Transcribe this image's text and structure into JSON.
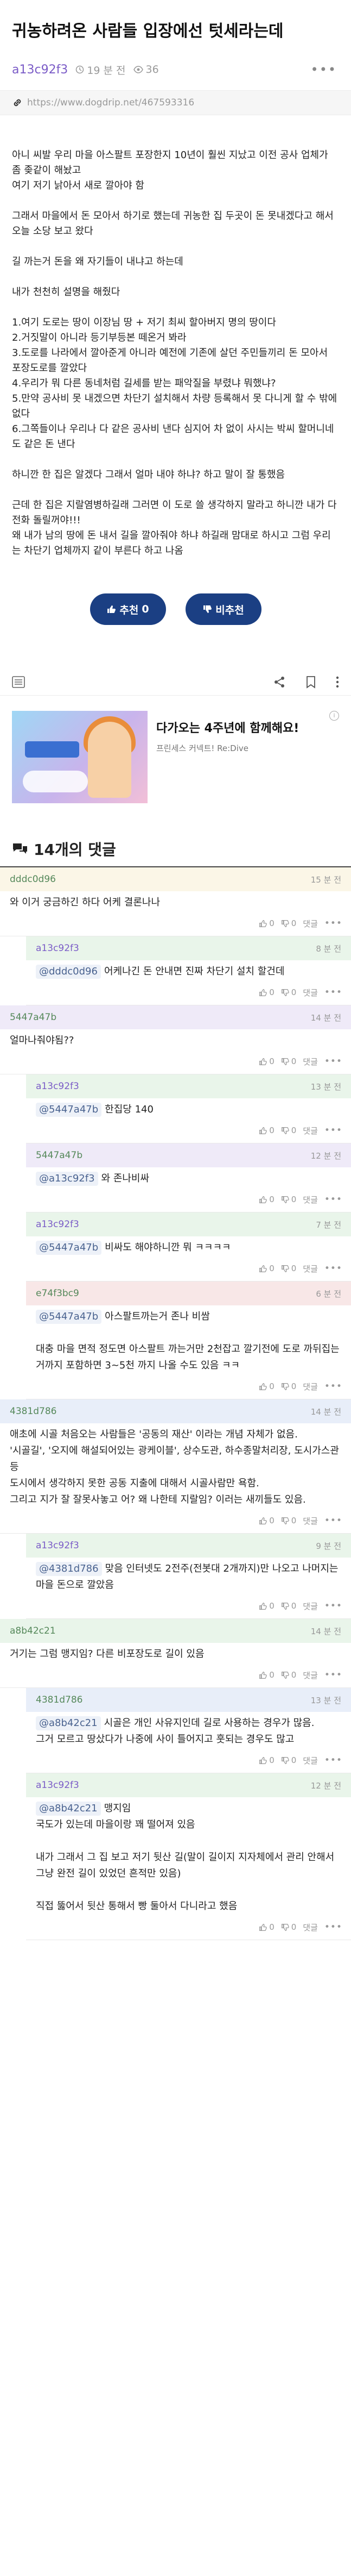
{
  "post": {
    "title": "귀농하려온 사람들 입장에선 텃세라는데",
    "author": "a13c92f3",
    "time": "19 분 전",
    "views": "36",
    "url": "https://www.dogdrip.net/467593316",
    "body": [
      "",
      "아니 씨발 우리 마을 아스팔트 포장한지 10년이 훨씬 지났고 이전 공사 업체가 좀 좆같이 해놨고",
      "여기 저기 낡아서 새로 깔아야 함",
      "",
      "그래서 마을에서 돈 모아서 하기로 했는데 귀농한 집 두곳이 돈 못내겠다고 해서 오늘 소당 보고 왔다",
      "",
      "길 까는거 돈을 왜 자기들이 내냐고 하는데",
      "",
      "내가 천천히 설명을 해줬다",
      "",
      "1.여기 도로는 땅이 이장님 땅 + 저기 최씨 할아버지 명의 땅이다",
      "2.거짓말이 아니라 등기부등본 떼온거 봐라",
      "3.도로를 나라에서 깔아준게 아니라 예전에 기존에 살던 주민들끼리 돈 모아서 포장도로를 깔았다",
      "4.우리가 뭐 다른 동네처럼 길세를 받는 패악질을 부렸냐 뭐했냐?",
      "5.만약 공사비 못 내겠으면 차단기 설치해서 차량 등록해서 못 다니게 할 수 밖에 없다",
      "6.그쪽들이나 우리나 다 같은 공사비 낸다 심지어 차 없이 사시는 박씨 할머니네도 같은 돈 낸다",
      "",
      "하니깐 한 집은 알겠다 그래서 얼마 내야 하냐? 하고 말이 잘 통했음",
      "",
      "근데 한 집은 지랄염병하길래 그러면 이 도로 쓸 생각하지 말라고 하니깐 내가 다 전화 돌릴꺼야!!!",
      "왜 내가 남의 땅에 돈 내서 길을 깔아줘야 하냐 하길래 맘대로 하시고 그럼 우리는 차단기 업체까지 같이 부른다 하고 나옴"
    ],
    "upvote_label": "추천",
    "upvote_count": "0",
    "downvote_label": "비추천"
  },
  "ad": {
    "title": "다가오는 4주년에 함께해요!",
    "subtitle": "프린세스 커넥트! Re:Dive",
    "info": "i"
  },
  "comments_header": {
    "title": "14개의 댓글"
  },
  "comments": [
    {
      "author": "dddc0d96",
      "time": "15 분 전",
      "mention": "",
      "body": "와 이거 궁금하긴 하다 어케 결론나나",
      "votes_up": "0",
      "votes_down": "0",
      "reply": "댓글",
      "level": 0,
      "color": "orange"
    },
    {
      "author": "a13c92f3",
      "time": "8 분 전",
      "mention": "@dddc0d96",
      "body": "어케나긴 돈 안내면 진짜 차단기 설치 할건데",
      "votes_up": "0",
      "votes_down": "0",
      "reply": "댓글",
      "level": 1,
      "color": "green"
    },
    {
      "author": "5447a47b",
      "time": "14 분 전",
      "mention": "",
      "body": "얼마나줘야됨??",
      "votes_up": "0",
      "votes_down": "0",
      "reply": "댓글",
      "level": 0,
      "color": "purple"
    },
    {
      "author": "a13c92f3",
      "time": "13 분 전",
      "mention": "@5447a47b",
      "body": "한집당 140",
      "votes_up": "0",
      "votes_down": "0",
      "reply": "댓글",
      "level": 1,
      "color": "green"
    },
    {
      "author": "5447a47b",
      "time": "12 분 전",
      "mention": "@a13c92f3",
      "body": "와 존나비싸",
      "votes_up": "0",
      "votes_down": "0",
      "reply": "댓글",
      "level": 1,
      "color": "purple"
    },
    {
      "author": "a13c92f3",
      "time": "7 분 전",
      "mention": "@5447a47b",
      "body": "비싸도 해야하니깐 뭐 ㅋㅋㅋㅋ",
      "votes_up": "0",
      "votes_down": "0",
      "reply": "댓글",
      "level": 1,
      "color": "green"
    },
    {
      "author": "e74f3bc9",
      "time": "6 분 전",
      "mention": "@5447a47b",
      "body": "아스팔트까는거 존나 비쌈\n\n대충 마을 면적 정도면 아스팔트 까는거만 2천잡고 깔기전에 도로 까뒤집는거까지 포함하면 3~5천 까지 나올 수도 있음 ㅋㅋ",
      "votes_up": "0",
      "votes_down": "0",
      "reply": "댓글",
      "level": 1,
      "color": "red"
    },
    {
      "author": "4381d786",
      "time": "14 분 전",
      "mention": "",
      "body": "애초에 시골 처음오는 사람들은 '공동의 재산' 이라는 개념 자체가 없음.\n'시골길', '오지에 해설되어있는 광케이블', 상수도관, 하수종말처리장, 도시가스관 등\n도시에서 생각하지 못한 공동 지출에 대해서 시골사람만 욕함.\n그리고 지가 잘 잘못사놓고 어? 왜 나한테 지랄임? 이러는 새끼들도 있음.",
      "votes_up": "0",
      "votes_down": "0",
      "reply": "댓글",
      "level": 0,
      "color": "blue"
    },
    {
      "author": "a13c92f3",
      "time": "9 분 전",
      "mention": "@4381d786",
      "body": "맞음 인터넷도 2전주(전봇대 2개까지)만 나오고 나머지는 마을 돈으로 깔았음",
      "votes_up": "0",
      "votes_down": "0",
      "reply": "댓글",
      "level": 1,
      "color": "green"
    },
    {
      "author": "a8b42c21",
      "time": "14 분 전",
      "mention": "",
      "body": "거기는 그럼 맹지임? 다른 비포장도로 길이 있음",
      "votes_up": "0",
      "votes_down": "0",
      "reply": "댓글",
      "level": 0,
      "color": "green"
    },
    {
      "author": "4381d786",
      "time": "13 분 전",
      "mention": "@a8b42c21",
      "body": "시골은 개인 사유지인데 길로 사용하는 경우가 많음.\n그거 모르고 땅샀다가 나중에 사이 틀어지고 훗되는 경우도 많고",
      "votes_up": "0",
      "votes_down": "0",
      "reply": "댓글",
      "level": 1,
      "color": "blue"
    },
    {
      "author": "a13c92f3",
      "time": "12 분 전",
      "mention": "@a8b42c21",
      "body": "맹지임\n국도가 있는데 마을이랑 꽤 떨어져 있음\n\n내가 그래서 그 집 보고 저기 뒷산 길(말이 길이지 지자체에서 관리 안해서 그냥 완전 길이 있었던 흔적만 있음)\n\n직접 뚫어서 뒷산 통해서 빵 둘아서 다니라고 했음",
      "votes_up": "0",
      "votes_down": "0",
      "reply": "댓글",
      "level": 1,
      "color": "green"
    }
  ]
}
